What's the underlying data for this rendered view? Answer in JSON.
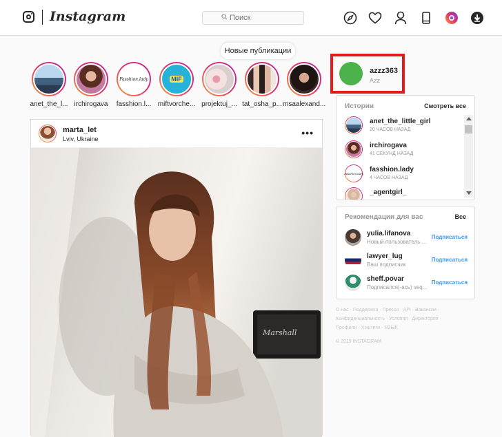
{
  "brand": {
    "name": "Instagram"
  },
  "search": {
    "placeholder": "Поиск"
  },
  "new_posts_label": "Новые публикации",
  "stories": [
    {
      "name": "anet_the_l..."
    },
    {
      "name": "irchirogava"
    },
    {
      "name": "fasshion.l...",
      "inner_text": "Fasshion.lady"
    },
    {
      "name": "miftvorche...",
      "inner_text": "MIF"
    },
    {
      "name": "projektuj_..."
    },
    {
      "name": "tat_osha_p..."
    },
    {
      "name": "msaalexand..."
    }
  ],
  "post": {
    "username": "marta_let",
    "location": "Lviv, Ukraine",
    "more": "•••",
    "speaker_brand": "Marshall"
  },
  "profile": {
    "username": "azzz363",
    "full_name": "Azz"
  },
  "stories_panel": {
    "title": "Истории",
    "see_all": "Смотреть все",
    "items": [
      {
        "name": "anet_the_little_girl",
        "time": "20 ЧАСОВ НАЗАД"
      },
      {
        "name": "irchirogava",
        "time": "41 СЕКУНД НАЗАД"
      },
      {
        "name": "fasshion.lady",
        "time": "4 ЧАСОВ НАЗАД",
        "inner_text": "Fasshion.lady"
      },
      {
        "name": "_agentgirl_",
        "time": ""
      }
    ]
  },
  "suggestions": {
    "title": "Рекомендации для вас",
    "all": "Все",
    "items": [
      {
        "name": "yulia.lifanova",
        "sub": "Новый пользователь ...",
        "action": "Подписаться"
      },
      {
        "name": "lawyer_lug",
        "sub": "Ваш подписчик",
        "action": "Подписаться"
      },
      {
        "name": "sheff.povar",
        "sub": "Подписался(-ась) veq...",
        "action": "Подписаться"
      }
    ]
  },
  "footer": {
    "links": "О нас · Поддержка · Пресса · API · Вакансии · Конфиденциальность · Условия · Директория · Профили · Хэштеги · ЯЗЫК",
    "copyright": "© 2019 INSTAGRAM"
  },
  "icons": [
    "compass-icon",
    "heart-icon",
    "profile-icon",
    "phone-icon",
    "instagram-badge-icon",
    "download-icon"
  ],
  "colors": {
    "accent": "#3897f0",
    "highlight_border": "#e31b1b",
    "avatar_green": "#4cb24c"
  }
}
